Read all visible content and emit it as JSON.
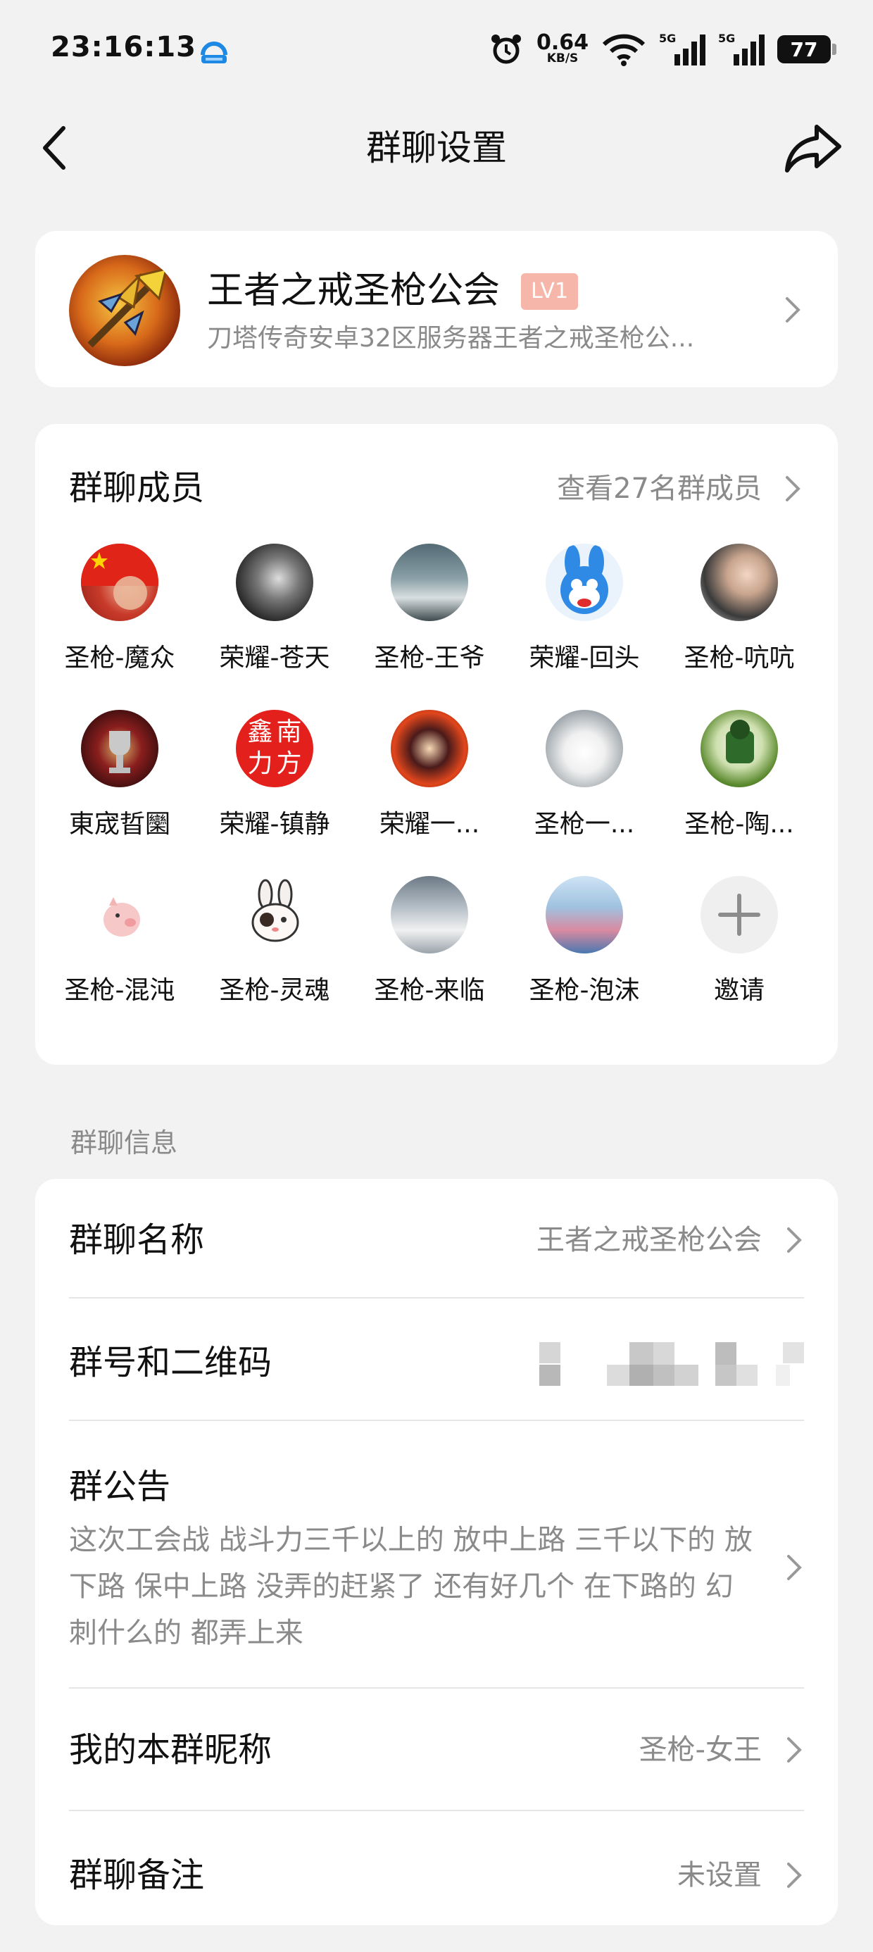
{
  "status": {
    "time": "23:16:13",
    "speed": "0.64",
    "speed_unit": "KB/S",
    "signal1": "5G",
    "signal2": "5G",
    "battery": "77"
  },
  "nav": {
    "title": "群聊设置"
  },
  "group": {
    "name": "王者之戒圣枪公会",
    "level": "LV1",
    "description": "刀塔传奇安卓32区服务器王者之戒圣枪公..."
  },
  "members": {
    "title": "群聊成员",
    "view_all": "查看27名群成员",
    "list": [
      {
        "name": "圣枪-魔众"
      },
      {
        "name": "荣耀-苍天"
      },
      {
        "name": "圣枪-王爷"
      },
      {
        "name": "荣耀-回头"
      },
      {
        "name": "圣枪-吭吭"
      },
      {
        "name": "東宬晢圞"
      },
      {
        "name": "荣耀-镇静"
      },
      {
        "name": "荣耀一..."
      },
      {
        "name": "圣枪一..."
      },
      {
        "name": "圣枪-陶..."
      },
      {
        "name": "圣枪-混沌"
      },
      {
        "name": "圣枪-灵魂"
      },
      {
        "name": "圣枪-来临"
      },
      {
        "name": "圣枪-泡沫"
      }
    ],
    "invite": "邀请",
    "avatar_glyphs": {
      "m6_a": "鑫",
      "m6_b": "南",
      "m6_c": "力",
      "m6_d": "方"
    }
  },
  "info": {
    "section_label": "群聊信息",
    "name_label": "群聊名称",
    "name_value": "王者之戒圣枪公会",
    "qr_label": "群号和二维码",
    "notice_label": "群公告",
    "notice_text": "这次工会战 战斗力三千以上的 放中上路 三千以下的 放下路 保中上路 没弄的赶紧了 还有好几个 在下路的 幻刺什么的 都弄上来",
    "nickname_label": "我的本群昵称",
    "nickname_value": "圣枪-女王",
    "remark_label": "群聊备注",
    "remark_value": "未设置"
  }
}
